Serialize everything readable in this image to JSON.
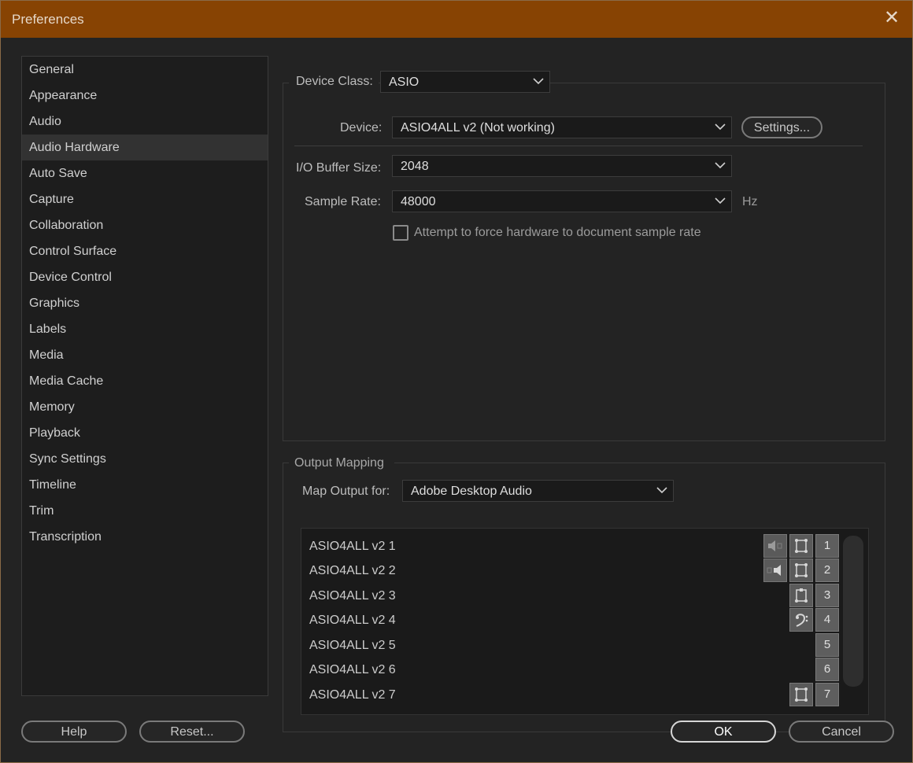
{
  "window": {
    "title": "Preferences"
  },
  "sidebar": {
    "items": [
      {
        "label": "General"
      },
      {
        "label": "Appearance"
      },
      {
        "label": "Audio"
      },
      {
        "label": "Audio Hardware",
        "active": true
      },
      {
        "label": "Auto Save"
      },
      {
        "label": "Capture"
      },
      {
        "label": "Collaboration"
      },
      {
        "label": "Control Surface"
      },
      {
        "label": "Device Control"
      },
      {
        "label": "Graphics"
      },
      {
        "label": "Labels"
      },
      {
        "label": "Media"
      },
      {
        "label": "Media Cache"
      },
      {
        "label": "Memory"
      },
      {
        "label": "Playback"
      },
      {
        "label": "Sync Settings"
      },
      {
        "label": "Timeline"
      },
      {
        "label": "Trim"
      },
      {
        "label": "Transcription"
      }
    ]
  },
  "hardware": {
    "device_class_label": "Device Class:",
    "device_class_value": "ASIO",
    "device_label": "Device:",
    "device_value": "ASIO4ALL v2 (Not working)",
    "settings_button": "Settings...",
    "buffer_label": "I/O Buffer Size:",
    "buffer_value": "2048",
    "sample_rate_label": "Sample Rate:",
    "sample_rate_value": "48000",
    "sample_rate_unit": "Hz",
    "force_rate_label": "Attempt to force hardware to document sample rate",
    "force_rate_checked": false
  },
  "output_mapping": {
    "title": "Output Mapping",
    "map_for_label": "Map Output for:",
    "map_for_value": "Adobe Desktop Audio",
    "channels": [
      {
        "name": "ASIO4ALL v2 1",
        "number": "1",
        "icons": [
          "speaker-left-icon",
          "surround-icon"
        ]
      },
      {
        "name": "ASIO4ALL v2 2",
        "number": "2",
        "icons": [
          "speaker-right-icon",
          "surround-icon"
        ]
      },
      {
        "name": "ASIO4ALL v2 3",
        "number": "3",
        "icons": [
          "surround-icon"
        ]
      },
      {
        "name": "ASIO4ALL v2 4",
        "number": "4",
        "icons": [
          "bass-clef-icon"
        ]
      },
      {
        "name": "ASIO4ALL v2 5",
        "number": "5",
        "icons": []
      },
      {
        "name": "ASIO4ALL v2 6",
        "number": "6",
        "icons": []
      },
      {
        "name": "ASIO4ALL v2 7",
        "number": "7",
        "icons": [
          "surround-icon"
        ]
      }
    ]
  },
  "footer": {
    "help_button": "Help",
    "reset_button": "Reset...",
    "ok_button": "OK",
    "cancel_button": "Cancel"
  },
  "colors": {
    "titlebar": "#874303",
    "panel_bg": "#232323",
    "accent_ok_border": "#d6d6d6"
  }
}
